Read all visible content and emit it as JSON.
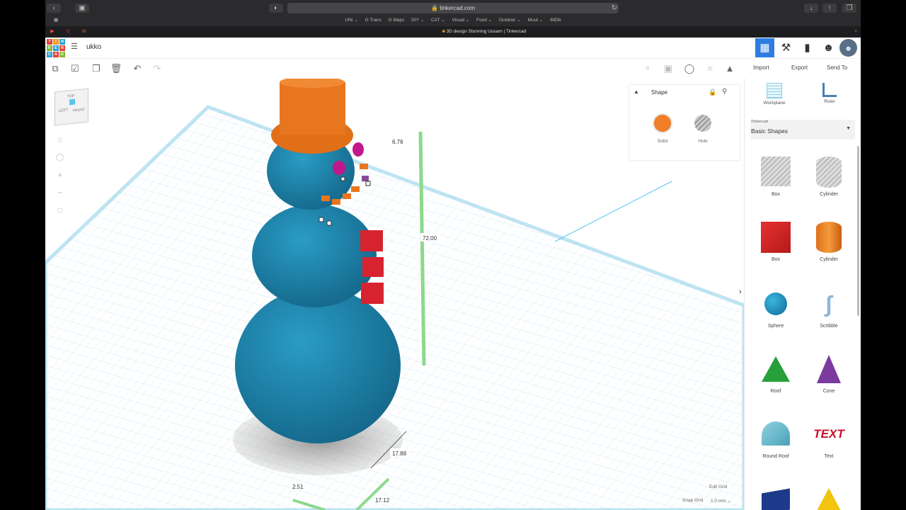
{
  "browser": {
    "url": "tinkercad.com",
    "favorites": [
      "UNI ⌄",
      "G Trans",
      "G Maps",
      "DIY ⌄",
      "CAT ⌄",
      "Visual ⌄",
      "Food ⌄",
      "Outdoor ⌄",
      "Muut ⌄",
      "IMDb"
    ],
    "tab_title": "3D design Stunning Uusam | Tinkercad"
  },
  "app": {
    "logo_letters": [
      "TIN",
      "KER",
      "CAD"
    ],
    "project_name": "ukko"
  },
  "topbar": {
    "import": "Import",
    "export": "Export",
    "send_to": "Send To"
  },
  "shape_panel": {
    "title": "Shape",
    "solid": "Solid",
    "hole": "Hole",
    "solid_color": "#f07e26"
  },
  "side_tools": {
    "workplane": "Workplane",
    "ruler": "Ruler"
  },
  "library": {
    "provider": "Tinkercad",
    "selected": "Basic Shapes",
    "shapes": [
      {
        "label": "Box",
        "icon": "box-hole-icon"
      },
      {
        "label": "Cylinder",
        "icon": "cylinder-hole-icon"
      },
      {
        "label": "Box",
        "icon": "box-icon"
      },
      {
        "label": "Cylinder",
        "icon": "cylinder-icon"
      },
      {
        "label": "Sphere",
        "icon": "sphere-icon"
      },
      {
        "label": "Scribble",
        "icon": "scribble-icon"
      },
      {
        "label": "Roof",
        "icon": "roof-icon"
      },
      {
        "label": "Cone",
        "icon": "cone-icon"
      },
      {
        "label": "Round Roof",
        "icon": "round-roof-icon"
      },
      {
        "label": "Text",
        "icon": "text-icon"
      }
    ]
  },
  "dimensions": {
    "top": "6.76",
    "height": "72.00",
    "depth": "17.88",
    "x_offset": "2.51",
    "width": "17.12"
  },
  "viewcube": {
    "left": "LEFT",
    "front": "FRONT",
    "top": "TOP"
  },
  "grid_controls": {
    "edit_grid": "Edit Grid",
    "snap_grid_label": "Snap Grid",
    "snap_grid_value": "1.0 mm ⌄"
  }
}
